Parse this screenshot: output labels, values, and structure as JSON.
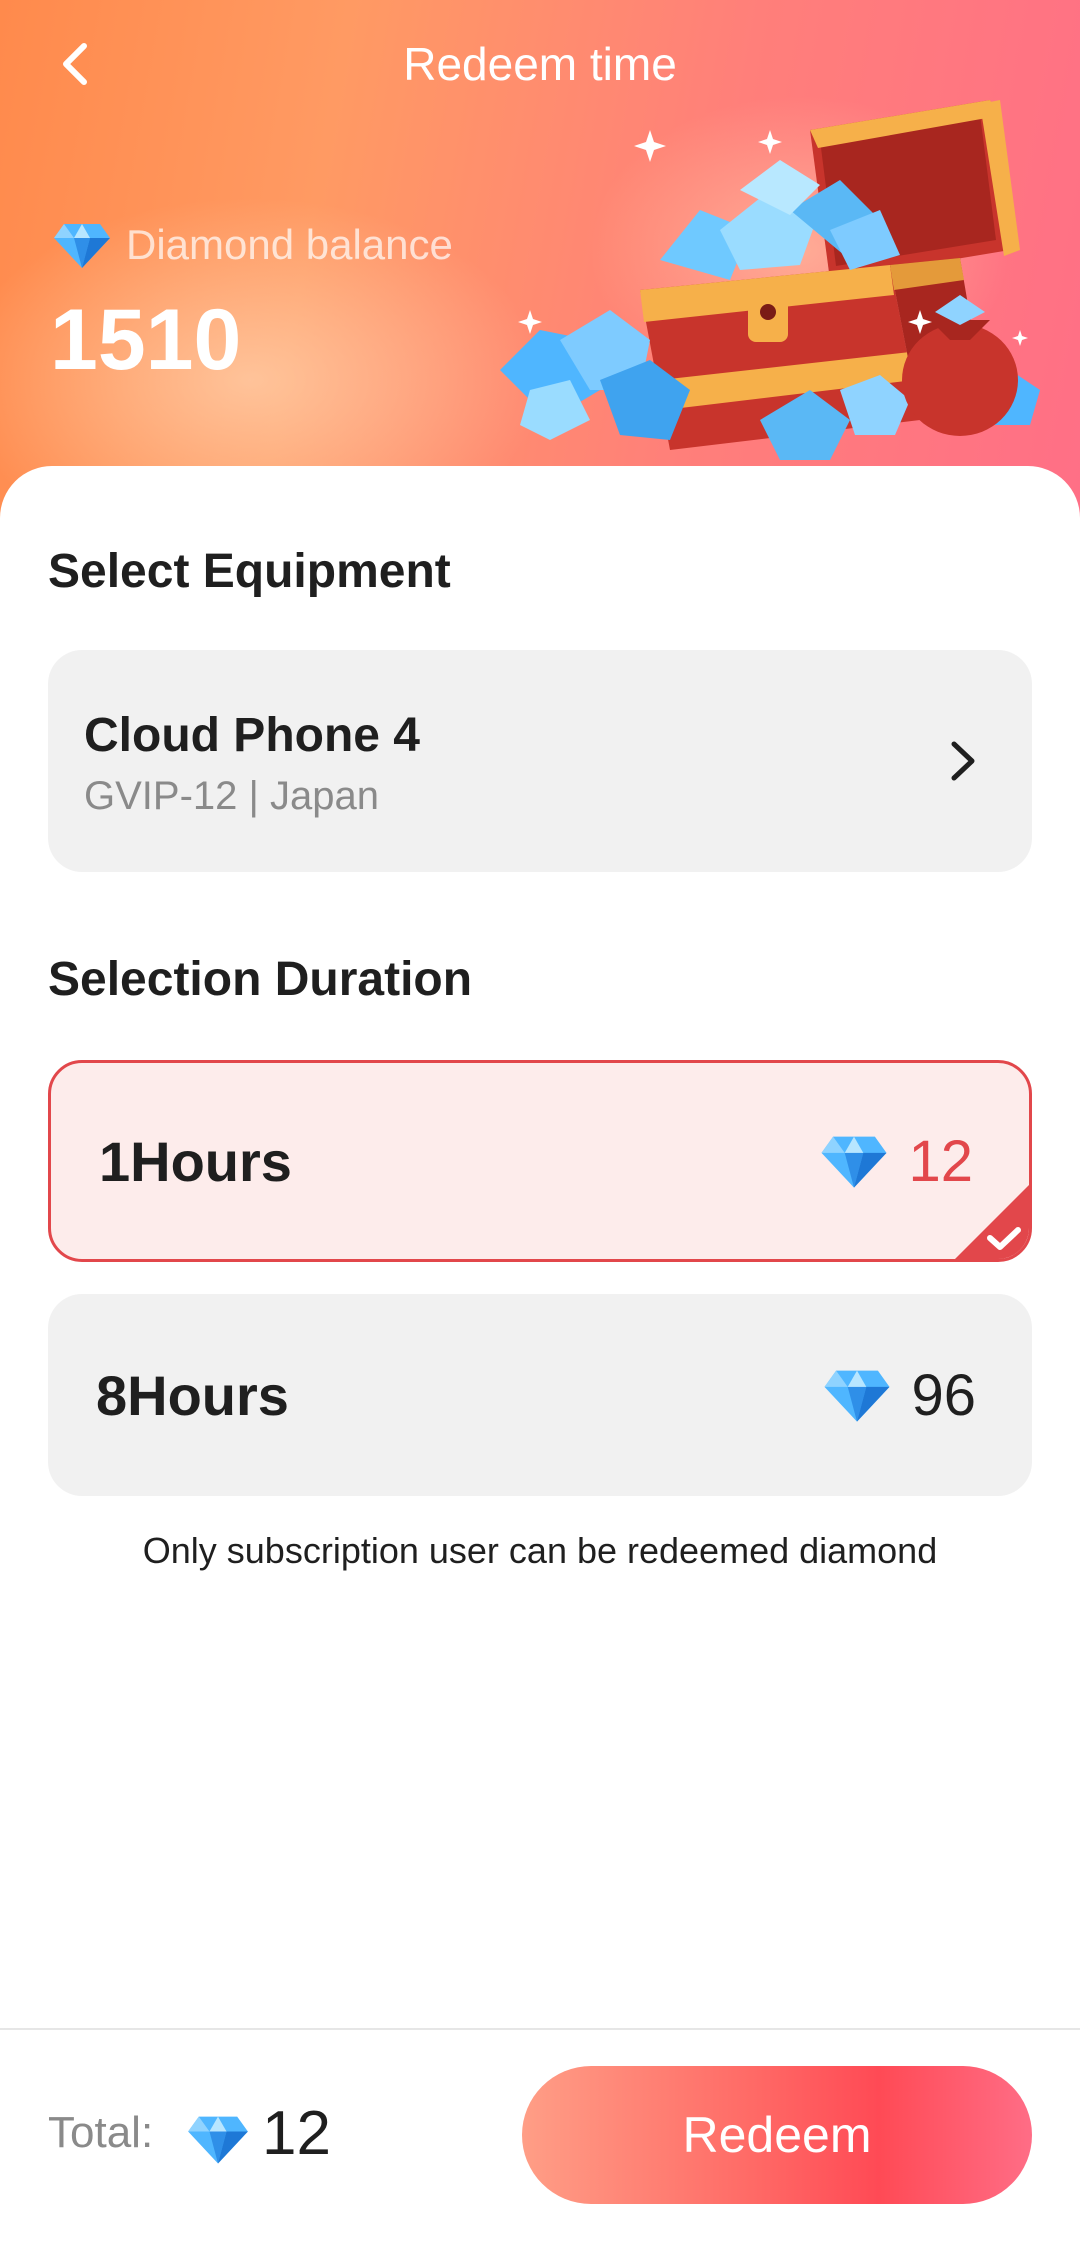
{
  "header": {
    "title": "Redeem time",
    "balance_label": "Diamond balance",
    "balance_value": "1510"
  },
  "equipment": {
    "section_title": "Select Equipment",
    "device_name": "Cloud Phone 4",
    "device_detail": "GVIP-12 | Japan"
  },
  "duration": {
    "section_title": "Selection Duration",
    "options": [
      {
        "label": "1Hours",
        "price": "12",
        "selected": true
      },
      {
        "label": "8Hours",
        "price": "96",
        "selected": false
      }
    ],
    "note": "Only subscription user can be redeemed diamond"
  },
  "footer": {
    "total_label": "Total:",
    "total_value": "12",
    "redeem_label": "Redeem"
  },
  "icons": {
    "back": "chevron-left-icon",
    "chevron": "chevron-right-icon",
    "diamond": "diamond-icon",
    "check": "check-icon",
    "treasure": "treasure-chest-illustration"
  },
  "colors": {
    "accent": "#e2474b",
    "selected_bg": "#fdeceb",
    "card_bg": "#f1f1f1"
  }
}
